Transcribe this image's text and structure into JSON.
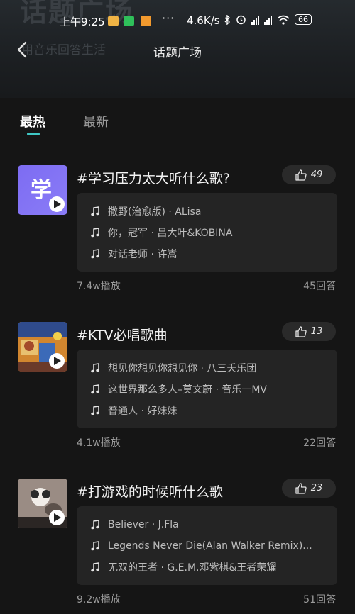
{
  "header": {
    "bg_title": "话题广场",
    "bg_subtitle": "用音乐回答生活",
    "title": "话题广场"
  },
  "status_bar": {
    "time": "上午9:25",
    "dots": "···",
    "speed": "4.6K/s",
    "battery": "66"
  },
  "tabs": [
    {
      "label": "最热",
      "active": true
    },
    {
      "label": "最新",
      "active": false
    }
  ],
  "colors": {
    "accent": "#3fc7c4",
    "thumb_purple": "#7d6cf2"
  },
  "topics": [
    {
      "thumb_char": "学",
      "title": "#学习压力太大听什么歌?",
      "likes": "49",
      "songs": [
        "撒野(治愈版) · ALisa",
        "你，冠军 · 吕大叶&KOBINA",
        "对话老师 · 许嵩"
      ],
      "plays": "7.4w播放",
      "answers": "45回答"
    },
    {
      "thumb_char": "",
      "title": "#KTV必唱歌曲",
      "likes": "13",
      "songs": [
        "想见你想见你想见你 · 八三夭乐团",
        "这世界那么多人–莫文蔚 · 音乐一MV",
        "普通人 · 好妹妹"
      ],
      "plays": "4.1w播放",
      "answers": "22回答"
    },
    {
      "thumb_char": "",
      "title": "#打游戏的时候听什么歌",
      "likes": "23",
      "songs": [
        "Believer · J.Fla",
        "Legends Never Die(Alan Walker Remix)...",
        "无双的王者 · G.E.M.邓紫棋&王者荣耀"
      ],
      "plays": "9.2w播放",
      "answers": "51回答"
    }
  ]
}
